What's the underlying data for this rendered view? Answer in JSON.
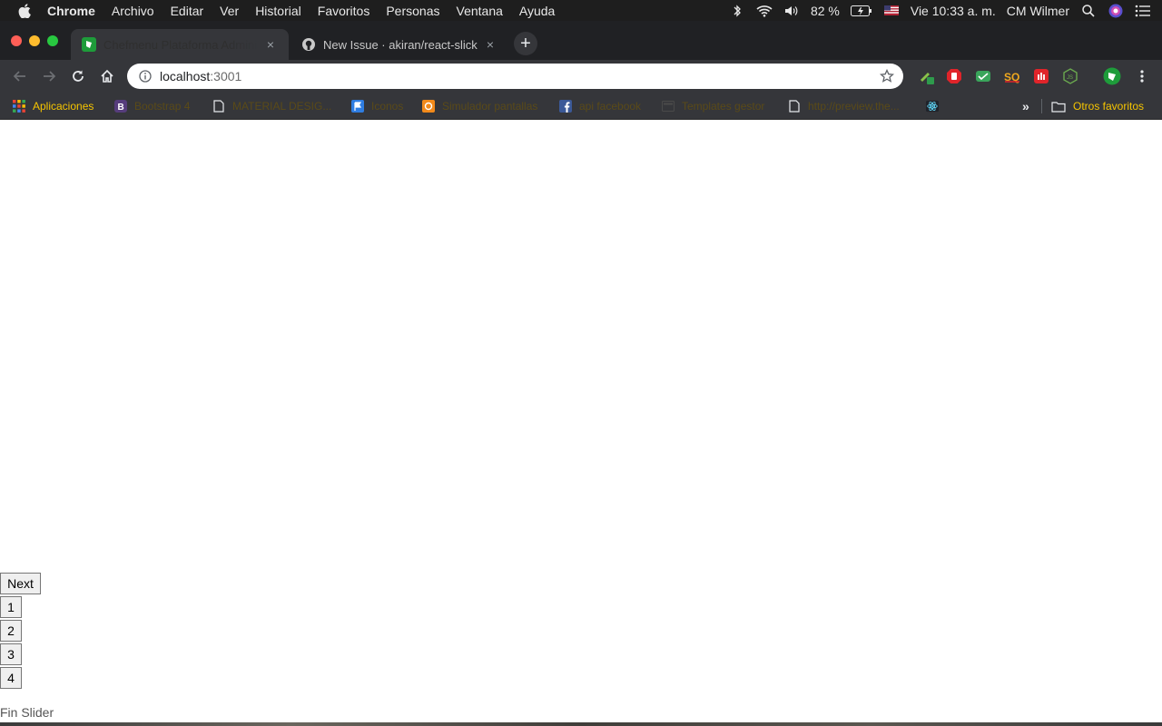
{
  "menubar": {
    "app_name": "Chrome",
    "items": [
      "Archivo",
      "Editar",
      "Ver",
      "Historial",
      "Favoritos",
      "Personas",
      "Ventana",
      "Ayuda"
    ],
    "battery": "82 %",
    "clock": "Vie 10:33 a. m.",
    "user": "CM Wilmer"
  },
  "tabs": [
    {
      "title": "Chefmenu Plataforma Administ",
      "icon": "chefmenu-icon",
      "active": true
    },
    {
      "title": "New Issue · akiran/react-slick",
      "icon": "github-icon",
      "active": false
    }
  ],
  "omnibox": {
    "host": "localhost",
    "port": ":3001"
  },
  "bookmarks": [
    {
      "label": "Aplicaciones",
      "icon": "apps-grid-icon"
    },
    {
      "label": "Bootstrap 4",
      "icon": "bootstrap-icon"
    },
    {
      "label": "MATERIAL DESIG...",
      "icon": "page-icon"
    },
    {
      "label": "Iconos",
      "icon": "flag-icon"
    },
    {
      "label": "Simulador pantallas",
      "icon": "simulator-icon"
    },
    {
      "label": "api facebook",
      "icon": "facebook-icon"
    },
    {
      "label": "Templates gestor",
      "icon": "template-icon"
    },
    {
      "label": "http://preview.the...",
      "icon": "page-icon"
    },
    {
      "label": "",
      "icon": "react-icon"
    }
  ],
  "other_bookmarks": "Otros favoritos",
  "page": {
    "next_label": "Next",
    "dots": [
      "1",
      "2",
      "3",
      "4"
    ],
    "footer_text": "Fin Slider"
  },
  "colors": {
    "menubar_bg": "#1e1e1e",
    "tabstrip_bg": "#202124",
    "toolbar_bg": "#35363a",
    "bookmark_accent": "#f5c400"
  }
}
